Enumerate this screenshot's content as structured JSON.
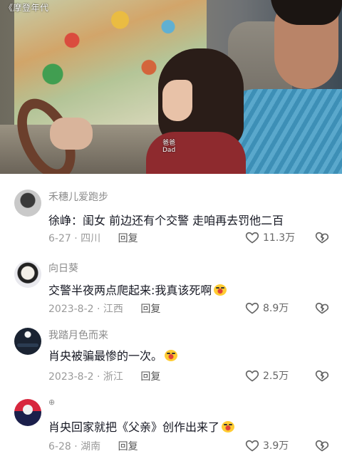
{
  "video": {
    "watermark": "《摩登年代",
    "subtitle_line1": "爸爸",
    "subtitle_line2": "Dad"
  },
  "comments": [
    {
      "username": "禾穗儿爱跑步",
      "text": "徐峥：闺女 前边还有个交警 走咱再去罚他二百",
      "emoji": "",
      "date_location": "6-27 · 四川",
      "reply_label": "回复",
      "likes": "11.3万",
      "avatar": "avatar-man-sunglasses",
      "like_icon": "heart-icon",
      "dislike_icon": "broken-heart-icon"
    },
    {
      "username": "向日葵",
      "text": "交警半夜两点爬起来:我真该死啊",
      "emoji": "crying-laughing-emoji",
      "date_location": "2023-8-2 · 江西",
      "reply_label": "回复",
      "likes": "8.9万",
      "avatar": "avatar-anime-girl",
      "like_icon": "heart-icon",
      "dislike_icon": "broken-heart-icon"
    },
    {
      "username": "我踏月色而来",
      "text": "肖央被骗最惨的一次。",
      "emoji": "crying-laughing-emoji",
      "date_location": "2023-8-2 · 浙江",
      "reply_label": "回复",
      "likes": "2.5万",
      "avatar": "avatar-night-moon",
      "like_icon": "heart-icon",
      "dislike_icon": "broken-heart-icon"
    },
    {
      "username": "",
      "text": "肖央回家就把《父亲》创作出来了",
      "emoji": "crying-laughing-emoji",
      "date_location": "6-28 · 湖南",
      "reply_label": "回复",
      "likes": "3.9万",
      "avatar": "avatar-red-blue",
      "like_icon": "heart-icon",
      "dislike_icon": "broken-heart-icon"
    }
  ]
}
